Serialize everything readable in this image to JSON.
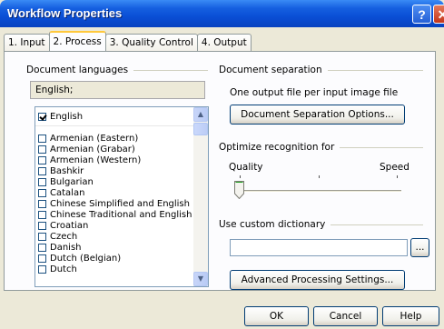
{
  "window": {
    "title": "Workflow Properties",
    "help_glyph": "?",
    "close_glyph": "✕"
  },
  "tabs": [
    {
      "label": "1. Input",
      "active": false
    },
    {
      "label": "2. Process",
      "active": true
    },
    {
      "label": "3. Quality Control",
      "active": false
    },
    {
      "label": "4. Output",
      "active": false
    }
  ],
  "languages": {
    "header": "Document languages",
    "selected_value": "English;",
    "items": [
      {
        "label": "English",
        "checked": true
      },
      {
        "label": "Armenian (Eastern)",
        "checked": false
      },
      {
        "label": "Armenian (Grabar)",
        "checked": false
      },
      {
        "label": "Armenian (Western)",
        "checked": false
      },
      {
        "label": "Bashkir",
        "checked": false
      },
      {
        "label": "Bulgarian",
        "checked": false
      },
      {
        "label": "Catalan",
        "checked": false
      },
      {
        "label": "Chinese Simplified and English",
        "checked": false
      },
      {
        "label": "Chinese Traditional and English",
        "checked": false
      },
      {
        "label": "Croatian",
        "checked": false
      },
      {
        "label": "Czech",
        "checked": false
      },
      {
        "label": "Danish",
        "checked": false
      },
      {
        "label": "Dutch (Belgian)",
        "checked": false
      },
      {
        "label": "Dutch",
        "checked": false
      }
    ]
  },
  "separation": {
    "header": "Document separation",
    "description": "One output file per input image file",
    "options_button": "Document Separation Options..."
  },
  "recognition": {
    "header": "Optimize recognition for",
    "left_label": "Quality",
    "right_label": "Speed",
    "slider_level": 0
  },
  "dictionary": {
    "header": "Use custom dictionary",
    "value": "",
    "browse_label": "..."
  },
  "advanced_button": "Advanced Processing Settings...",
  "footer": {
    "ok": "OK",
    "cancel": "Cancel",
    "help": "Help"
  }
}
